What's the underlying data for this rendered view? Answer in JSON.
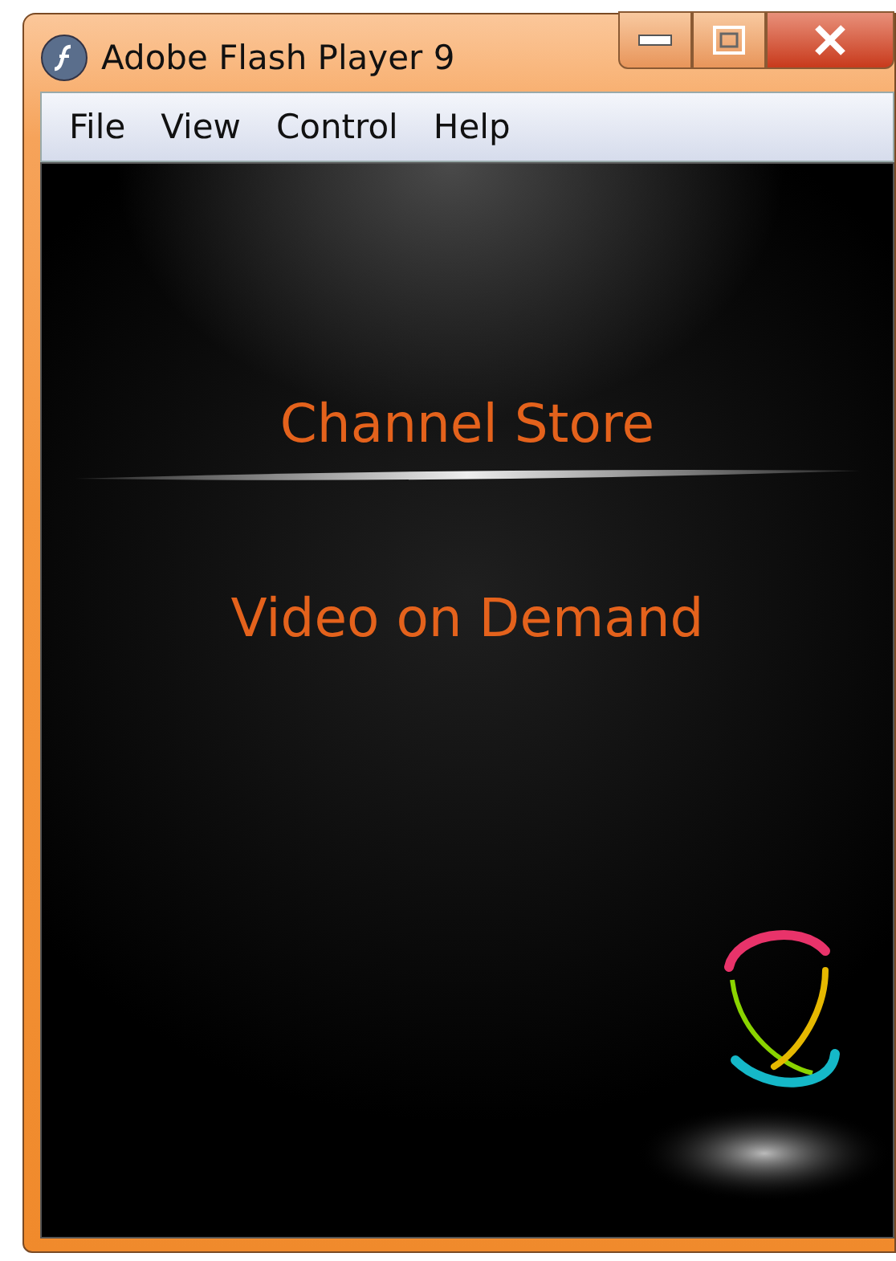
{
  "window": {
    "title": "Adobe Flash Player 9"
  },
  "menu": [
    {
      "label": "File"
    },
    {
      "label": "View"
    },
    {
      "label": "Control"
    },
    {
      "label": "Help"
    }
  ],
  "content": {
    "links": [
      {
        "label": "Channel Store"
      },
      {
        "label": "Video on Demand"
      }
    ]
  }
}
